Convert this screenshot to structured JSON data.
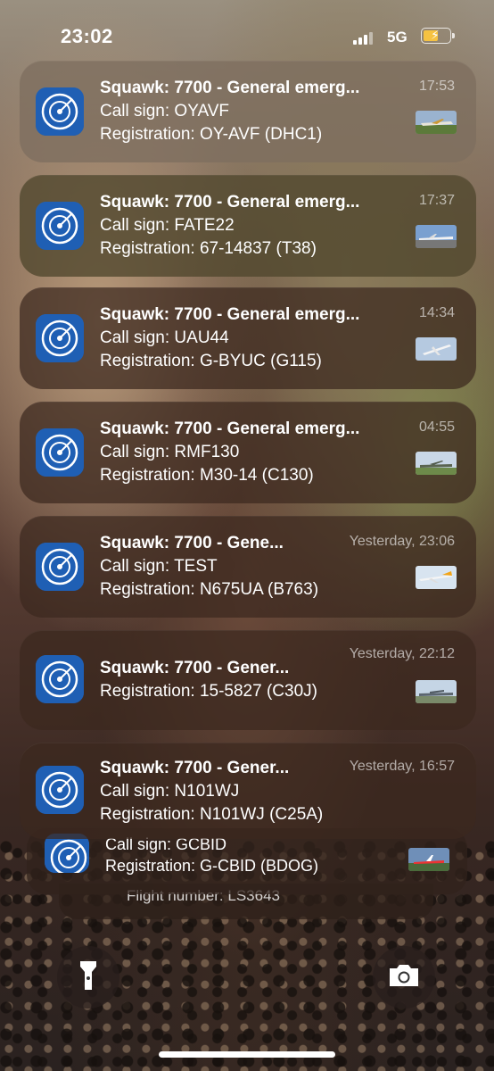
{
  "status_bar": {
    "time": "23:02",
    "network": "5G"
  },
  "notifications": [
    {
      "title": "Squawk: 7700 - General emerg...",
      "callsign": "Call sign: OYAVF",
      "registration": "Registration: OY-AVF (DHC1)",
      "time": "17:53"
    },
    {
      "title": "Squawk: 7700 - General emerg...",
      "callsign": "Call sign: FATE22",
      "registration": "Registration: 67-14837 (T38)",
      "time": "17:37"
    },
    {
      "title": "Squawk: 7700 - General emerg...",
      "callsign": "Call sign: UAU44",
      "registration": "Registration: G-BYUC (G115)",
      "time": "14:34"
    },
    {
      "title": "Squawk: 7700 - General emerg...",
      "callsign": "Call sign: RMF130",
      "registration": "Registration: M30-14 (C130)",
      "time": "04:55"
    },
    {
      "title": "Squawk: 7700 - Gene...",
      "callsign": "Call sign: TEST",
      "registration": "Registration: N675UA (B763)",
      "time": "Yesterday, 23:06"
    },
    {
      "title": "Squawk: 7700 - Gener...",
      "registration": "Registration: 15-5827 (C30J)",
      "time": "Yesterday, 22:12"
    },
    {
      "title": "Squawk: 7700 - Gener...",
      "callsign": "Call sign: N101WJ",
      "registration": "Registration: N101WJ (C25A)",
      "time": "Yesterday, 16:57"
    }
  ],
  "stacked": {
    "callsign": "Call sign: GCBID",
    "registration": "Registration: G-CBID (BDOG)",
    "flight_number": "Flight number: LS3643"
  },
  "lockscreen": {
    "flashlight_icon": "flashlight-icon",
    "camera_icon": "camera-icon"
  },
  "colors": {
    "app_icon": "#1a4f9c",
    "battery_fill": "#f5c242"
  }
}
